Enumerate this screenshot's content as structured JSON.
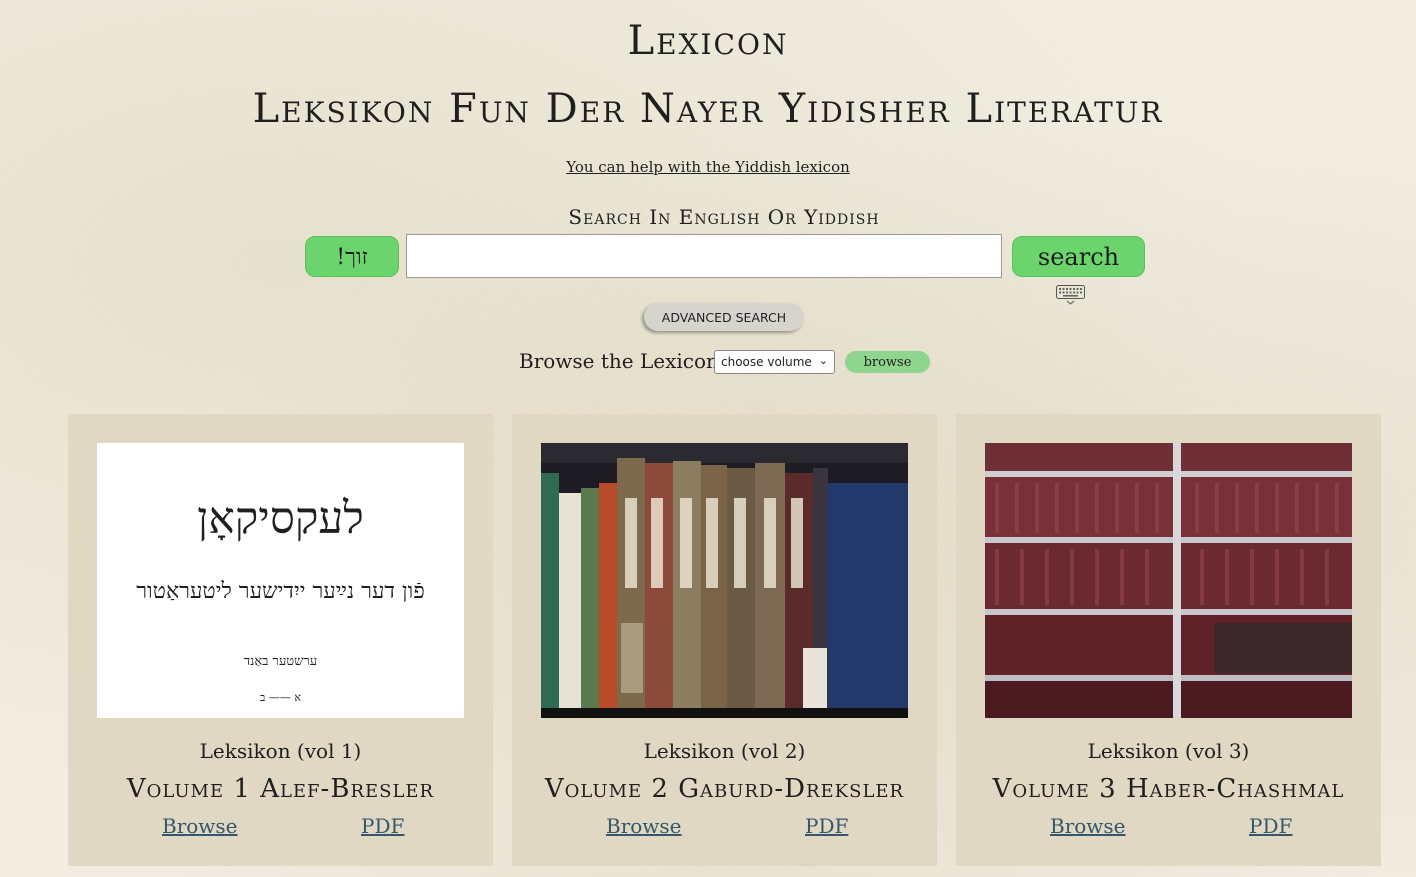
{
  "header": {
    "title": "Lexicon",
    "subtitle": "Leksikon Fun Der Nayer Yidisher Literatur",
    "help_link": "You can help with the Yiddish lexicon"
  },
  "search": {
    "label": "Search In English Or Yiddish",
    "zuk_label": "זוך!",
    "input_value": "",
    "search_label": "search",
    "keyboard_icon": "keyboard-icon",
    "advanced_label": "ADVANCED SEARCH"
  },
  "browse": {
    "label": "Browse the Lexicon:",
    "select_value": "choose volume",
    "button_label": "browse"
  },
  "volumes": [
    {
      "caption": "Leksikon (vol 1)",
      "title": "Volume 1 Alef-Bresler",
      "browse": "Browse",
      "pdf": "PDF",
      "cover_title": "לעקסיקאָן",
      "cover_subtitle": "פֿון דער נײַער ייִדישער ליטעראַטור",
      "cover_band": "ערשטער באַנד",
      "cover_range": "א —— ב"
    },
    {
      "caption": "Leksikon (vol 2)",
      "title": "Volume 2 Gaburd-Dreksler",
      "browse": "Browse",
      "pdf": "PDF"
    },
    {
      "caption": "Leksikon (vol 3)",
      "title": "Volume 3 Haber-Chashmal",
      "browse": "Browse",
      "pdf": "PDF"
    }
  ],
  "colors": {
    "accent_green": "#6cd46c",
    "card_bg": "#e0d8c2",
    "link": "#34576e"
  }
}
